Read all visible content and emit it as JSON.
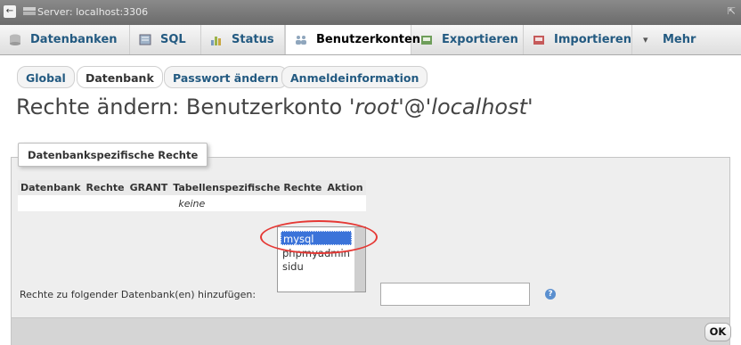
{
  "server": {
    "title": "Server: localhost:3306",
    "back_icon": "←",
    "collapse_icon": "⇱"
  },
  "nav": {
    "tabs": [
      {
        "label": "Datenbanken",
        "icon": "database-icon"
      },
      {
        "label": "SQL",
        "icon": "sql-icon"
      },
      {
        "label": "Status",
        "icon": "status-icon"
      },
      {
        "label": "Benutzerkonten",
        "icon": "users-icon"
      },
      {
        "label": "Exportieren",
        "icon": "export-icon"
      },
      {
        "label": "Importieren",
        "icon": "import-icon"
      },
      {
        "label": "Mehr",
        "icon": "chevron-down-icon"
      }
    ],
    "chevron": "▾"
  },
  "subtabs": [
    "Global",
    "Datenbank",
    "Passwort ändern",
    "Anmeldeinformation"
  ],
  "heading": {
    "prefix": "Rechte ändern: Benutzerkonto '",
    "user": "root",
    "mid": "'@'",
    "host": "localhost",
    "suffix": "'"
  },
  "section": {
    "legend": "Datenbankspezifische Rechte",
    "columns": [
      "Datenbank",
      "Rechte",
      "GRANT",
      "Tabellenspezifische Rechte",
      "Aktion"
    ],
    "empty_text": "keine"
  },
  "dblist": {
    "options": [
      "mysql",
      "phpmyadmin",
      "sidu"
    ]
  },
  "add": {
    "label": "Rechte zu folgender Datenbank(en) hinzufügen:",
    "value": ""
  },
  "ok_label": "OK",
  "colors": {
    "link": "#235a81",
    "selection": "#3b73d9",
    "highlight": "#e53935"
  }
}
